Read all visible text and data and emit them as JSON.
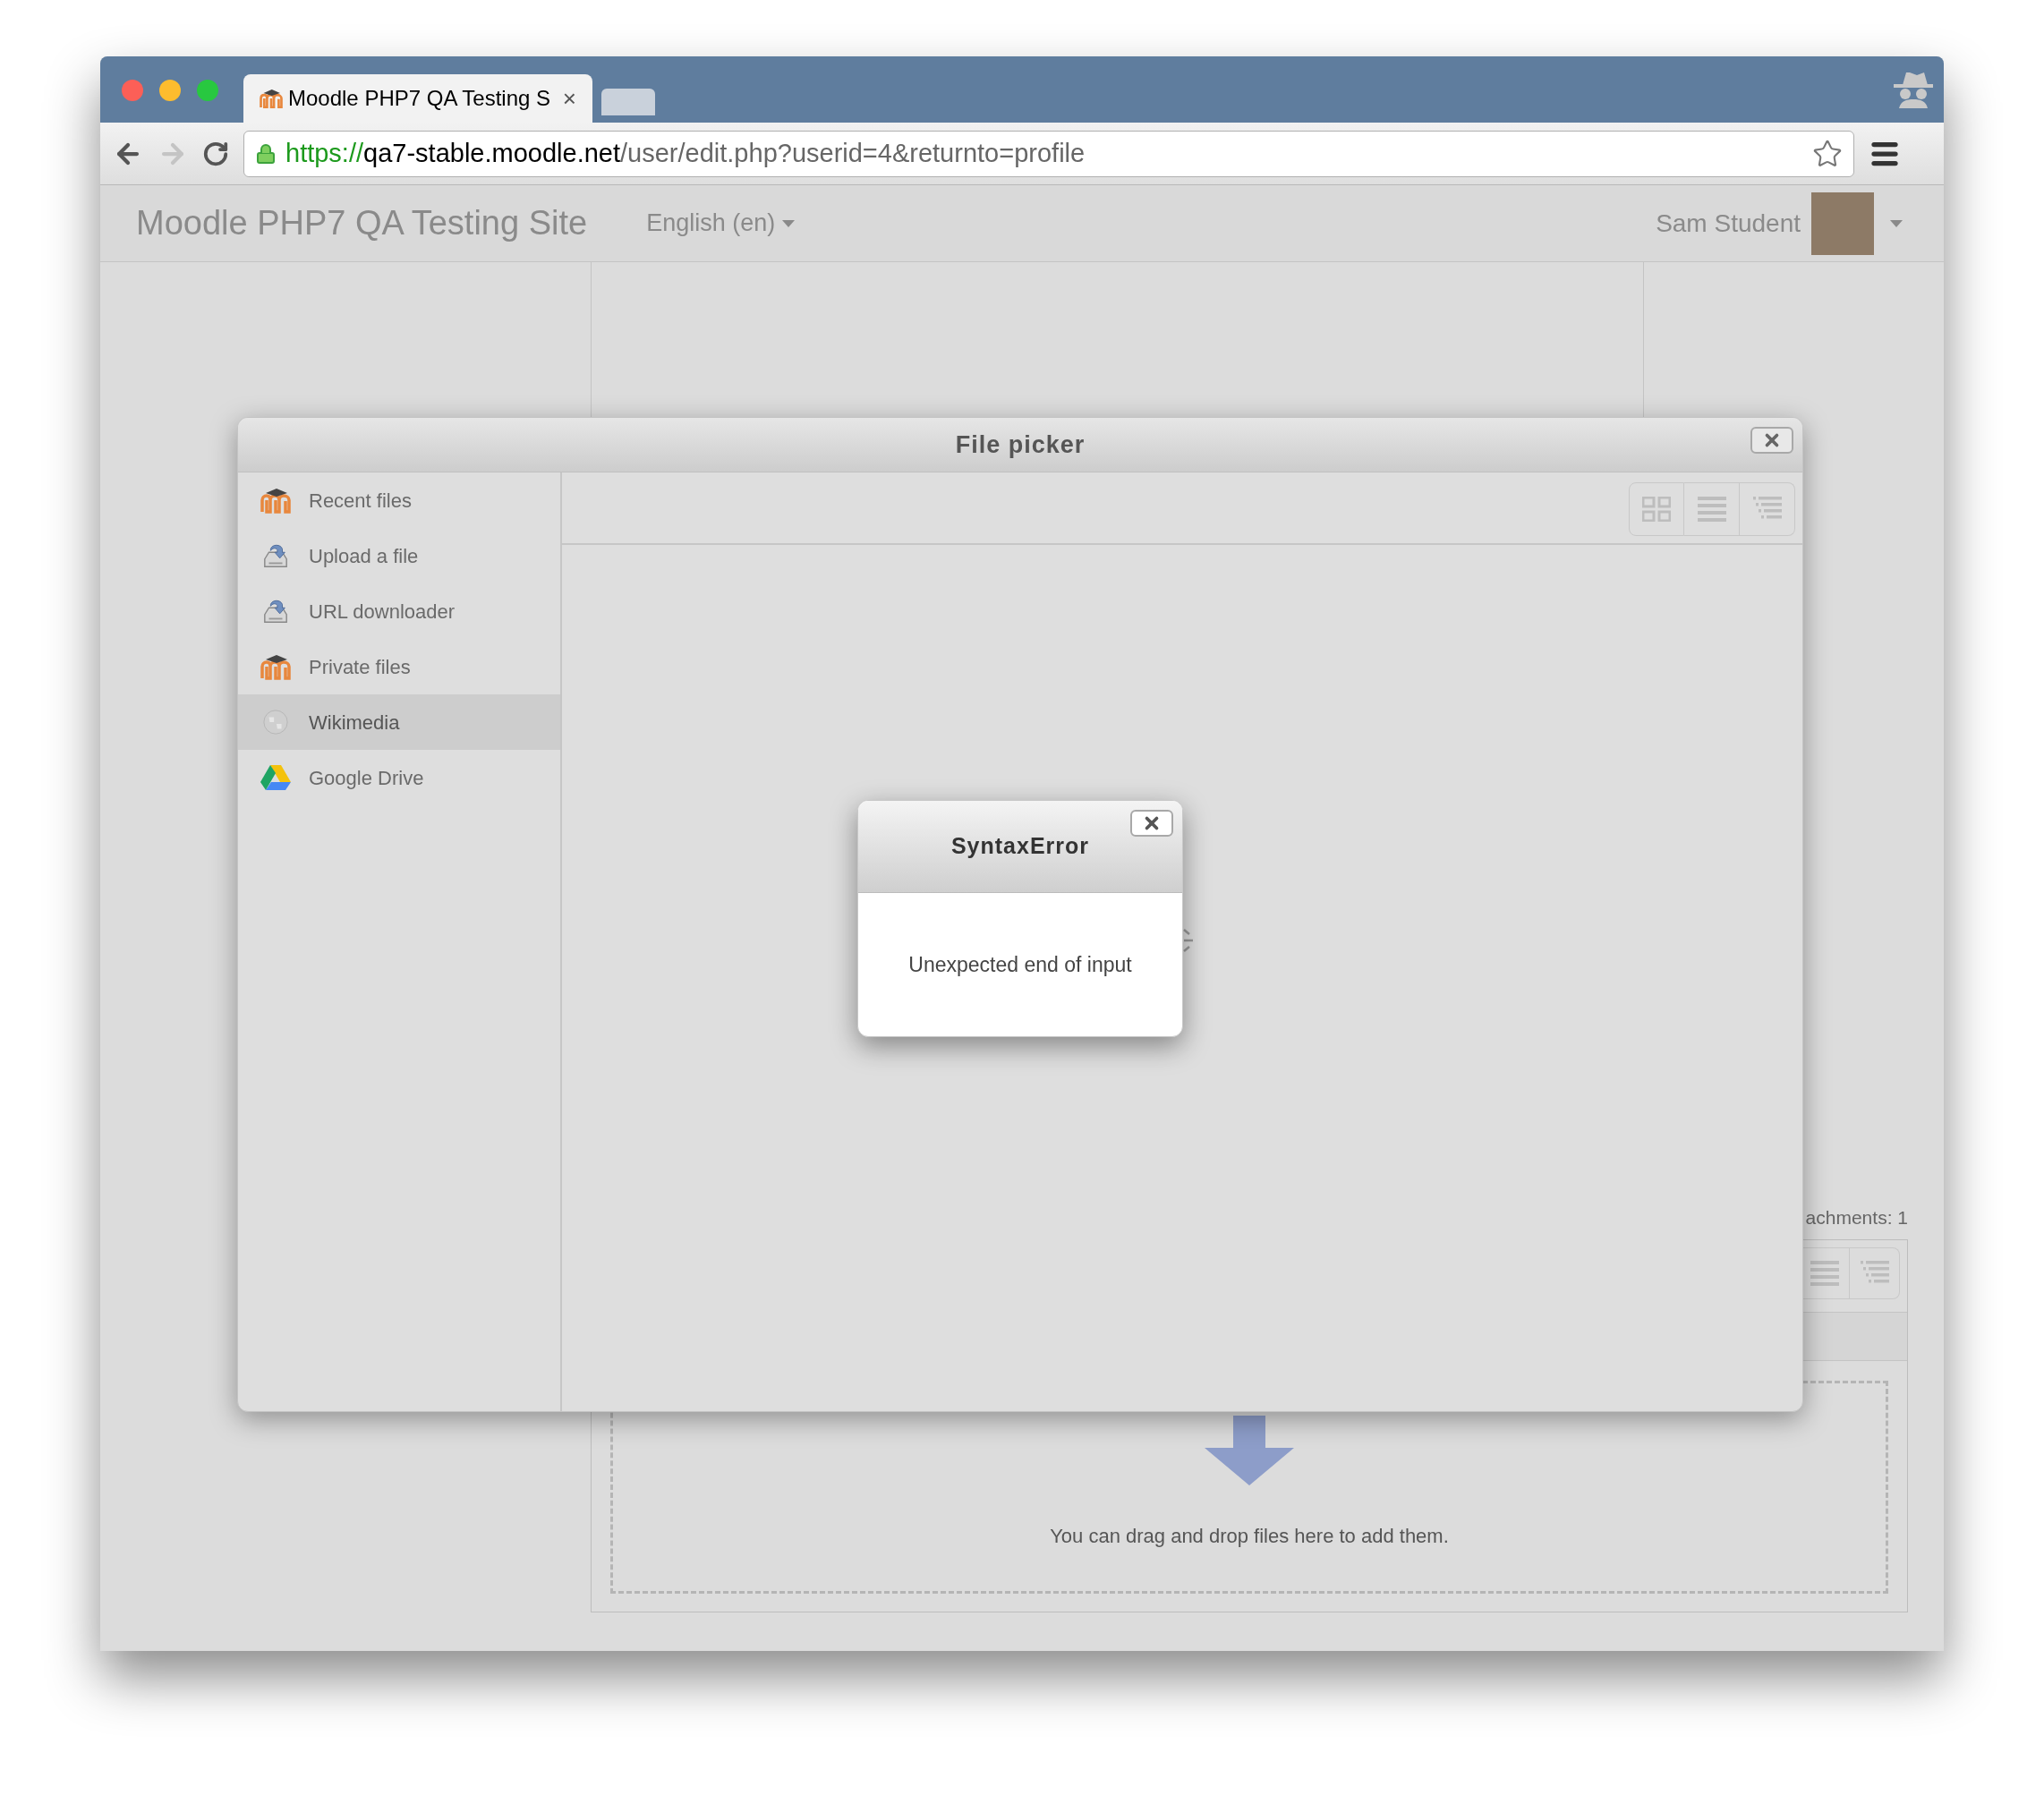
{
  "browser": {
    "tab": {
      "title": "Moodle PHP7 QA Testing S",
      "close": "×"
    },
    "forward_enabled": false,
    "address": {
      "scheme": "https://",
      "host": "qa7-stable.moodle.net",
      "path": "/user/edit.php?userid=4&returnto=profile"
    }
  },
  "navbar": {
    "site_name": "Moodle PHP7 QA Testing Site",
    "language": "English (en)",
    "user": "Sam Student"
  },
  "page": {
    "attachments_label": "achments: 1",
    "dropzone_text": "You can drag and drop files here to add them."
  },
  "file_picker": {
    "title": "File picker",
    "repositories": [
      {
        "label": "Recent files",
        "kind": "moodle",
        "selected": false
      },
      {
        "label": "Upload a file",
        "kind": "upload",
        "selected": false
      },
      {
        "label": "URL downloader",
        "kind": "upload",
        "selected": false
      },
      {
        "label": "Private files",
        "kind": "moodle",
        "selected": false
      },
      {
        "label": "Wikimedia",
        "kind": "wikimedia",
        "selected": true
      },
      {
        "label": "Google Drive",
        "kind": "drive",
        "selected": false
      }
    ]
  },
  "error_dialog": {
    "title": "SyntaxError",
    "message": "Unexpected end of input"
  }
}
